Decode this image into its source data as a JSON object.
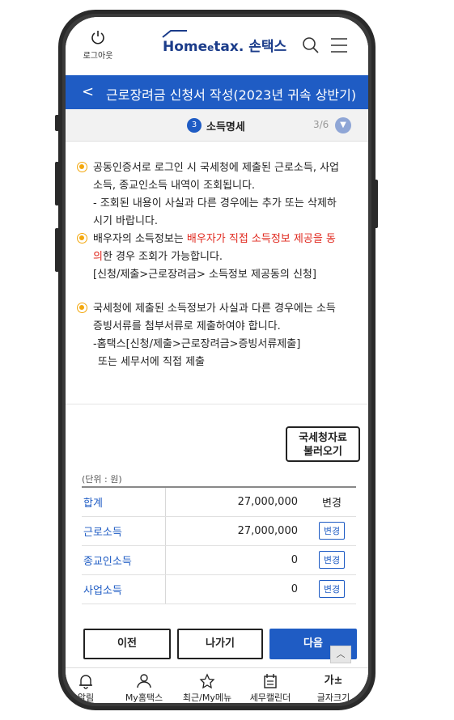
{
  "header": {
    "logout_label": "로그아웃",
    "logo_home": "Home",
    "logo_tax": "tax.",
    "logo_son": "손택스"
  },
  "titlebar": {
    "back": "<",
    "title": "근로장려금 신청서 작성(2023년 귀속 상반기)"
  },
  "step": {
    "number": "3",
    "label": "소득명세",
    "count": "3/6"
  },
  "notices": {
    "n1_l1": "공동인증서로 로그인 시 국세청에 제출된 근로소득, 사업",
    "n1_l2": "소득, 종교인소득 내역이 조회됩니다.",
    "n1_l3": "- 조회된 내용이 사실과 다른 경우에는 추가 또는 삭제하",
    "n1_l4": "시기 바랍니다.",
    "n2_l1a": "배우자의 소득정보는 ",
    "n2_l1b": "배우자가 직접 소득정보 제공을 동",
    "n2_l2a": "의",
    "n2_l2b": "한 경우 조회가 가능합니다.",
    "n2_l3": "[신청/제출>근로장려금> 소득정보 제공동의 신청]",
    "n3_l1": "국세청에 제출된 소득정보가 사실과 다른 경우에는 소득",
    "n3_l2": "증빙서류를 첨부서류로 제출하여야 합니다.",
    "n3_l3": "-홈택스[신청/제출>근로장려금>증빙서류제출]",
    "n3_l4": "또는 세무서에 직접 제출"
  },
  "fetch": {
    "line1": "국세청자료",
    "line2": "불러오기"
  },
  "unit": "(단위 : 원)",
  "table": {
    "rows": [
      {
        "label": "합계",
        "amount": "27,000,000",
        "action": "변경"
      },
      {
        "label": "근로소득",
        "amount": "27,000,000",
        "action": "변경"
      },
      {
        "label": "종교인소득",
        "amount": "0",
        "action": "변경"
      },
      {
        "label": "사업소득",
        "amount": "0",
        "action": "변경"
      }
    ]
  },
  "buttons": {
    "prev": "이전",
    "exit": "나가기",
    "next": "다음"
  },
  "tabs": {
    "alarm": "알림",
    "my": "My홈택스",
    "recent": "최근/My메뉴",
    "calendar": "세무캘린더",
    "fontsize": "글자크기",
    "fontsize_icon": "가±"
  },
  "colors": {
    "primary": "#1f5cc4",
    "accent_red": "#e0281e",
    "bullet": "#f3a70c"
  }
}
